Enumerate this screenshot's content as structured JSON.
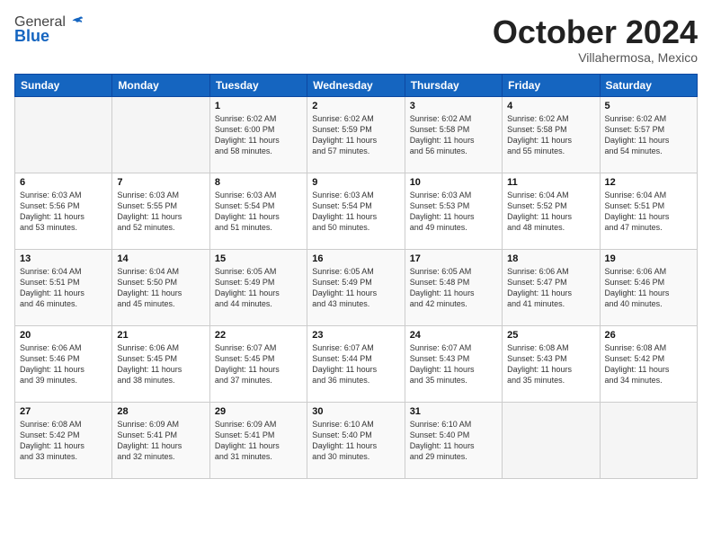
{
  "logo": {
    "general": "General",
    "blue": "Blue"
  },
  "title": "October 2024",
  "subtitle": "Villahermosa, Mexico",
  "weekdays": [
    "Sunday",
    "Monday",
    "Tuesday",
    "Wednesday",
    "Thursday",
    "Friday",
    "Saturday"
  ],
  "weeks": [
    [
      {
        "day": "",
        "info": ""
      },
      {
        "day": "",
        "info": ""
      },
      {
        "day": "1",
        "info": "Sunrise: 6:02 AM\nSunset: 6:00 PM\nDaylight: 11 hours\nand 58 minutes."
      },
      {
        "day": "2",
        "info": "Sunrise: 6:02 AM\nSunset: 5:59 PM\nDaylight: 11 hours\nand 57 minutes."
      },
      {
        "day": "3",
        "info": "Sunrise: 6:02 AM\nSunset: 5:58 PM\nDaylight: 11 hours\nand 56 minutes."
      },
      {
        "day": "4",
        "info": "Sunrise: 6:02 AM\nSunset: 5:58 PM\nDaylight: 11 hours\nand 55 minutes."
      },
      {
        "day": "5",
        "info": "Sunrise: 6:02 AM\nSunset: 5:57 PM\nDaylight: 11 hours\nand 54 minutes."
      }
    ],
    [
      {
        "day": "6",
        "info": "Sunrise: 6:03 AM\nSunset: 5:56 PM\nDaylight: 11 hours\nand 53 minutes."
      },
      {
        "day": "7",
        "info": "Sunrise: 6:03 AM\nSunset: 5:55 PM\nDaylight: 11 hours\nand 52 minutes."
      },
      {
        "day": "8",
        "info": "Sunrise: 6:03 AM\nSunset: 5:54 PM\nDaylight: 11 hours\nand 51 minutes."
      },
      {
        "day": "9",
        "info": "Sunrise: 6:03 AM\nSunset: 5:54 PM\nDaylight: 11 hours\nand 50 minutes."
      },
      {
        "day": "10",
        "info": "Sunrise: 6:03 AM\nSunset: 5:53 PM\nDaylight: 11 hours\nand 49 minutes."
      },
      {
        "day": "11",
        "info": "Sunrise: 6:04 AM\nSunset: 5:52 PM\nDaylight: 11 hours\nand 48 minutes."
      },
      {
        "day": "12",
        "info": "Sunrise: 6:04 AM\nSunset: 5:51 PM\nDaylight: 11 hours\nand 47 minutes."
      }
    ],
    [
      {
        "day": "13",
        "info": "Sunrise: 6:04 AM\nSunset: 5:51 PM\nDaylight: 11 hours\nand 46 minutes."
      },
      {
        "day": "14",
        "info": "Sunrise: 6:04 AM\nSunset: 5:50 PM\nDaylight: 11 hours\nand 45 minutes."
      },
      {
        "day": "15",
        "info": "Sunrise: 6:05 AM\nSunset: 5:49 PM\nDaylight: 11 hours\nand 44 minutes."
      },
      {
        "day": "16",
        "info": "Sunrise: 6:05 AM\nSunset: 5:49 PM\nDaylight: 11 hours\nand 43 minutes."
      },
      {
        "day": "17",
        "info": "Sunrise: 6:05 AM\nSunset: 5:48 PM\nDaylight: 11 hours\nand 42 minutes."
      },
      {
        "day": "18",
        "info": "Sunrise: 6:06 AM\nSunset: 5:47 PM\nDaylight: 11 hours\nand 41 minutes."
      },
      {
        "day": "19",
        "info": "Sunrise: 6:06 AM\nSunset: 5:46 PM\nDaylight: 11 hours\nand 40 minutes."
      }
    ],
    [
      {
        "day": "20",
        "info": "Sunrise: 6:06 AM\nSunset: 5:46 PM\nDaylight: 11 hours\nand 39 minutes."
      },
      {
        "day": "21",
        "info": "Sunrise: 6:06 AM\nSunset: 5:45 PM\nDaylight: 11 hours\nand 38 minutes."
      },
      {
        "day": "22",
        "info": "Sunrise: 6:07 AM\nSunset: 5:45 PM\nDaylight: 11 hours\nand 37 minutes."
      },
      {
        "day": "23",
        "info": "Sunrise: 6:07 AM\nSunset: 5:44 PM\nDaylight: 11 hours\nand 36 minutes."
      },
      {
        "day": "24",
        "info": "Sunrise: 6:07 AM\nSunset: 5:43 PM\nDaylight: 11 hours\nand 35 minutes."
      },
      {
        "day": "25",
        "info": "Sunrise: 6:08 AM\nSunset: 5:43 PM\nDaylight: 11 hours\nand 35 minutes."
      },
      {
        "day": "26",
        "info": "Sunrise: 6:08 AM\nSunset: 5:42 PM\nDaylight: 11 hours\nand 34 minutes."
      }
    ],
    [
      {
        "day": "27",
        "info": "Sunrise: 6:08 AM\nSunset: 5:42 PM\nDaylight: 11 hours\nand 33 minutes."
      },
      {
        "day": "28",
        "info": "Sunrise: 6:09 AM\nSunset: 5:41 PM\nDaylight: 11 hours\nand 32 minutes."
      },
      {
        "day": "29",
        "info": "Sunrise: 6:09 AM\nSunset: 5:41 PM\nDaylight: 11 hours\nand 31 minutes."
      },
      {
        "day": "30",
        "info": "Sunrise: 6:10 AM\nSunset: 5:40 PM\nDaylight: 11 hours\nand 30 minutes."
      },
      {
        "day": "31",
        "info": "Sunrise: 6:10 AM\nSunset: 5:40 PM\nDaylight: 11 hours\nand 29 minutes."
      },
      {
        "day": "",
        "info": ""
      },
      {
        "day": "",
        "info": ""
      }
    ]
  ]
}
